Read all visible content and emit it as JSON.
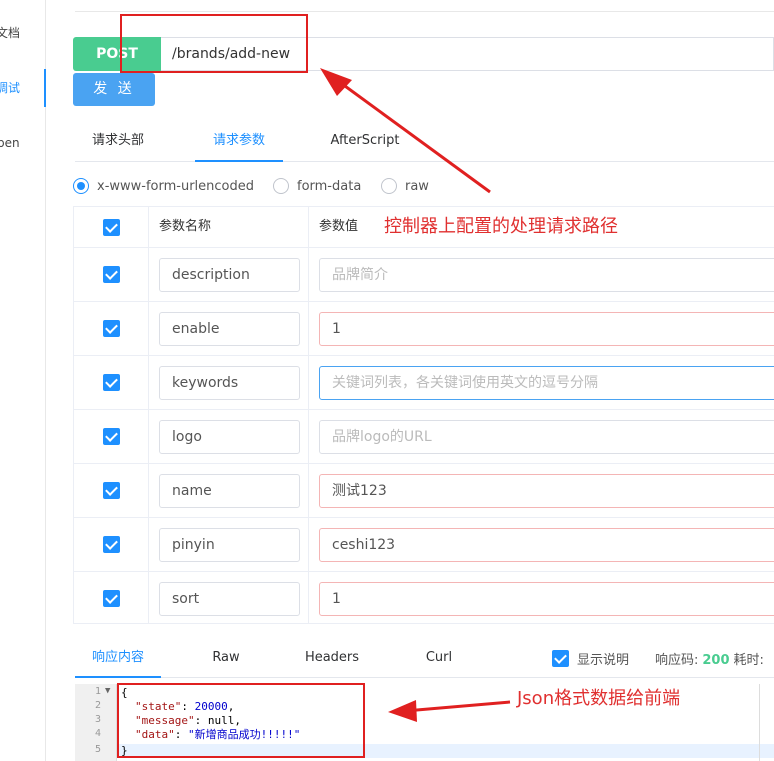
{
  "sidebar": {
    "items": [
      {
        "label": "文档"
      },
      {
        "label": "调试"
      },
      {
        "label": "pen"
      }
    ]
  },
  "request": {
    "method": "POST",
    "url": "/brands/add-new",
    "send_label": "发 送"
  },
  "tabs": [
    {
      "label": "请求头部"
    },
    {
      "label": "请求参数"
    },
    {
      "label": "AfterScript"
    }
  ],
  "body_types": [
    {
      "label": "x-www-form-urlencoded",
      "checked": true
    },
    {
      "label": "form-data",
      "checked": false
    },
    {
      "label": "raw",
      "checked": false
    }
  ],
  "params": {
    "header": {
      "name": "参数名称",
      "value": "参数值"
    },
    "rows": [
      {
        "name": "description",
        "value": "",
        "placeholder": "品牌简介"
      },
      {
        "name": "enable",
        "value": "1",
        "placeholder": ""
      },
      {
        "name": "keywords",
        "value": "",
        "placeholder": "关键词列表，各关键词使用英文的逗号分隔"
      },
      {
        "name": "logo",
        "value": "",
        "placeholder": "品牌logo的URL"
      },
      {
        "name": "name",
        "value": "测试123",
        "placeholder": ""
      },
      {
        "name": "pinyin",
        "value": "ceshi123",
        "placeholder": ""
      },
      {
        "name": "sort",
        "value": "1",
        "placeholder": ""
      }
    ]
  },
  "annotations": {
    "path_note": "控制器上配置的处理请求路径",
    "json_note": "Json格式数据给前端"
  },
  "response": {
    "tabs": [
      {
        "label": "响应内容"
      },
      {
        "label": "Raw"
      },
      {
        "label": "Headers"
      },
      {
        "label": "Curl"
      }
    ],
    "show_desc_label": "显示说明",
    "status_label": "响应码:",
    "status_code": "200",
    "time_label": "耗时:",
    "lines": [
      {
        "num": "1",
        "text": "{"
      },
      {
        "num": "2",
        "key": "\"state\"",
        "sep": ": ",
        "val": "20000",
        "end": ","
      },
      {
        "num": "3",
        "key": "\"message\"",
        "sep": ": ",
        "val": "null",
        "end": ","
      },
      {
        "num": "4",
        "key": "\"data\"",
        "sep": ": ",
        "val": "\"新增商品成功!!!!!\"",
        "end": ""
      },
      {
        "num": "5",
        "text": "}"
      }
    ]
  },
  "colors": {
    "accent": "#1e90ff",
    "post": "#49cc90",
    "annotation": "#e02020"
  }
}
